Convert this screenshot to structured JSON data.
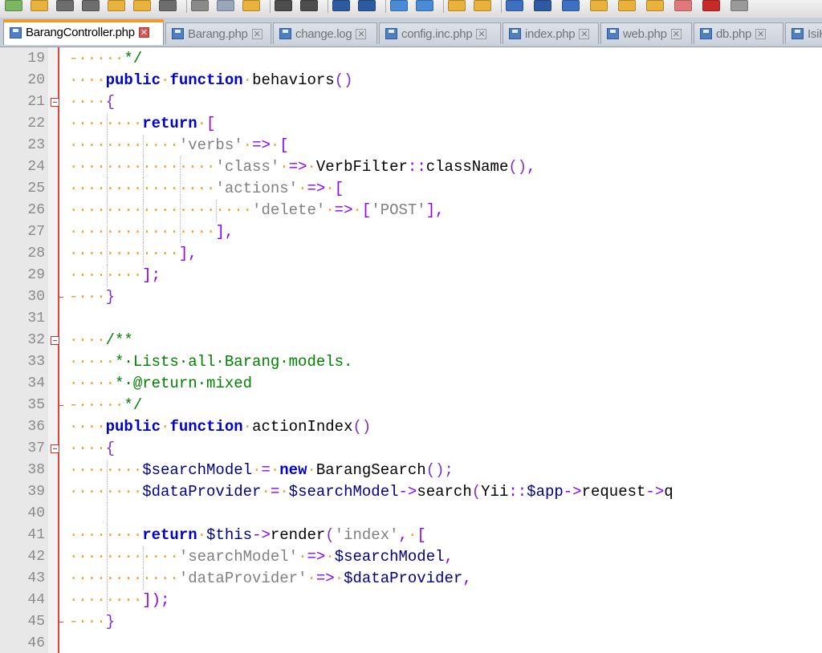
{
  "toolbar": {
    "icons": [
      "new-file-icon",
      "open-folder-icon",
      "save-icon",
      "save-all-icon",
      "close-icon",
      "close-all-icon",
      "print-icon",
      "cut-icon",
      "copy-icon",
      "paste-icon",
      "undo-icon",
      "redo-icon",
      "find-icon",
      "replace-icon",
      "zoom-in-icon",
      "zoom-out-icon",
      "sync-v-icon",
      "sync-h-icon",
      "word-wrap-icon",
      "all-chars-icon",
      "indent-guide-icon",
      "lang-icon",
      "doc-map-icon",
      "func-list-icon",
      "monitor-icon",
      "record-macro-icon",
      "stop-macro-icon"
    ]
  },
  "tabs": [
    {
      "label": "BarangController.php",
      "active": true
    },
    {
      "label": "Barang.php",
      "active": false
    },
    {
      "label": "change.log",
      "active": false
    },
    {
      "label": "config.inc.php",
      "active": false
    },
    {
      "label": "index.php",
      "active": false
    },
    {
      "label": "web.php",
      "active": false
    },
    {
      "label": "db.php",
      "active": false
    },
    {
      "label": "IsiKe",
      "active": false
    }
  ],
  "colors": {
    "keyword": "#0000c8",
    "operator": "#8b00ff",
    "string": "#808080",
    "comment": "#008000",
    "whitespace": "#f0a030",
    "fold_line": "#e34234",
    "active_tab_accent": "#f19a2c"
  },
  "editor": {
    "lines": [
      {
        "n": "19",
        "fold": "none",
        "guides": [],
        "tokens": [
          [
            "ws",
            "-·····"
          ],
          [
            "cm",
            "*/"
          ]
        ]
      },
      {
        "n": "20",
        "fold": "none",
        "guides": [],
        "tokens": [
          [
            "ws",
            "····"
          ],
          [
            "kw",
            "public"
          ],
          [
            "ws",
            "·"
          ],
          [
            "kw",
            "function"
          ],
          [
            "ws",
            "·"
          ],
          [
            "fn",
            "behaviors"
          ],
          [
            "p",
            "()"
          ]
        ]
      },
      {
        "n": "21",
        "fold": "open",
        "guides": [],
        "tokens": [
          [
            "ws",
            "····"
          ],
          [
            "p",
            "{"
          ]
        ]
      },
      {
        "n": "22",
        "fold": "none",
        "guides": [
          1
        ],
        "tokens": [
          [
            "ws",
            "········"
          ],
          [
            "kw",
            "return"
          ],
          [
            "ws",
            "·"
          ],
          [
            "op",
            "["
          ]
        ]
      },
      {
        "n": "23",
        "fold": "none",
        "guides": [
          1,
          2
        ],
        "tokens": [
          [
            "ws",
            "············"
          ],
          [
            "str",
            "'verbs'"
          ],
          [
            "ws",
            "·"
          ],
          [
            "op",
            "=>"
          ],
          [
            "ws",
            "·"
          ],
          [
            "op",
            "["
          ]
        ]
      },
      {
        "n": "24",
        "fold": "none",
        "guides": [
          1,
          2,
          3
        ],
        "tokens": [
          [
            "ws",
            "················"
          ],
          [
            "str",
            "'class'"
          ],
          [
            "ws",
            "·"
          ],
          [
            "op",
            "=>"
          ],
          [
            "ws",
            "·"
          ],
          [
            "id",
            "VerbFilter"
          ],
          [
            "op",
            "::"
          ],
          [
            "id",
            "className"
          ],
          [
            "p",
            "()"
          ],
          [
            "op",
            ","
          ]
        ]
      },
      {
        "n": "25",
        "fold": "none",
        "guides": [
          1,
          2,
          3
        ],
        "tokens": [
          [
            "ws",
            "················"
          ],
          [
            "str",
            "'actions'"
          ],
          [
            "ws",
            "·"
          ],
          [
            "op",
            "=>"
          ],
          [
            "ws",
            "·"
          ],
          [
            "op",
            "["
          ]
        ]
      },
      {
        "n": "26",
        "fold": "none",
        "guides": [
          1,
          2,
          3,
          4
        ],
        "tokens": [
          [
            "ws",
            "····················"
          ],
          [
            "str",
            "'delete'"
          ],
          [
            "ws",
            "·"
          ],
          [
            "op",
            "=>"
          ],
          [
            "ws",
            "·"
          ],
          [
            "op",
            "["
          ],
          [
            "str",
            "'POST'"
          ],
          [
            "op",
            "],"
          ]
        ]
      },
      {
        "n": "27",
        "fold": "none",
        "guides": [
          1,
          2,
          3
        ],
        "tokens": [
          [
            "ws",
            "················"
          ],
          [
            "op",
            "],"
          ]
        ]
      },
      {
        "n": "28",
        "fold": "none",
        "guides": [
          1,
          2
        ],
        "tokens": [
          [
            "ws",
            "············"
          ],
          [
            "op",
            "],"
          ]
        ]
      },
      {
        "n": "29",
        "fold": "none",
        "guides": [
          1
        ],
        "tokens": [
          [
            "ws",
            "········"
          ],
          [
            "op",
            "];"
          ]
        ]
      },
      {
        "n": "30",
        "fold": "close",
        "guides": [],
        "tokens": [
          [
            "ws",
            "-···"
          ],
          [
            "p",
            "}"
          ]
        ]
      },
      {
        "n": "31",
        "fold": "none",
        "guides": [],
        "tokens": []
      },
      {
        "n": "32",
        "fold": "open",
        "guides": [],
        "tokens": [
          [
            "ws",
            "····"
          ],
          [
            "cm",
            "/**"
          ]
        ]
      },
      {
        "n": "33",
        "fold": "none",
        "guides": [],
        "tokens": [
          [
            "ws",
            "·····"
          ],
          [
            "cm",
            "*·Lists·all·Barang·models."
          ]
        ]
      },
      {
        "n": "34",
        "fold": "none",
        "guides": [],
        "tokens": [
          [
            "ws",
            "·····"
          ],
          [
            "cm",
            "*·@return·mixed"
          ]
        ]
      },
      {
        "n": "35",
        "fold": "close",
        "guides": [],
        "tokens": [
          [
            "ws",
            "-·····"
          ],
          [
            "cm",
            "*/"
          ]
        ]
      },
      {
        "n": "36",
        "fold": "none",
        "guides": [],
        "tokens": [
          [
            "ws",
            "····"
          ],
          [
            "kw",
            "public"
          ],
          [
            "ws",
            "·"
          ],
          [
            "kw",
            "function"
          ],
          [
            "ws",
            "·"
          ],
          [
            "fn",
            "actionIndex"
          ],
          [
            "p",
            "()"
          ]
        ]
      },
      {
        "n": "37",
        "fold": "open",
        "guides": [],
        "tokens": [
          [
            "ws",
            "····"
          ],
          [
            "p",
            "{"
          ]
        ]
      },
      {
        "n": "38",
        "fold": "none",
        "guides": [
          1
        ],
        "tokens": [
          [
            "ws",
            "········"
          ],
          [
            "var",
            "$searchModel"
          ],
          [
            "ws",
            "·"
          ],
          [
            "op",
            "="
          ],
          [
            "ws",
            "·"
          ],
          [
            "kw2",
            "new"
          ],
          [
            "ws",
            "·"
          ],
          [
            "id",
            "BarangSearch"
          ],
          [
            "p",
            "();"
          ]
        ]
      },
      {
        "n": "39",
        "fold": "none",
        "guides": [
          1
        ],
        "tokens": [
          [
            "ws",
            "········"
          ],
          [
            "var",
            "$dataProvider"
          ],
          [
            "ws",
            "·"
          ],
          [
            "op",
            "="
          ],
          [
            "ws",
            "·"
          ],
          [
            "var",
            "$searchModel"
          ],
          [
            "op",
            "->"
          ],
          [
            "id",
            "search"
          ],
          [
            "p",
            "("
          ],
          [
            "id",
            "Yii"
          ],
          [
            "op",
            "::"
          ],
          [
            "var",
            "$app"
          ],
          [
            "op",
            "->"
          ],
          [
            "id",
            "request"
          ],
          [
            "op",
            "->"
          ],
          [
            "id",
            "q"
          ]
        ]
      },
      {
        "n": "40",
        "fold": "none",
        "guides": [
          1
        ],
        "tokens": []
      },
      {
        "n": "41",
        "fold": "none",
        "guides": [
          1
        ],
        "tokens": [
          [
            "ws",
            "········"
          ],
          [
            "kw",
            "return"
          ],
          [
            "ws",
            "·"
          ],
          [
            "var",
            "$this"
          ],
          [
            "op",
            "->"
          ],
          [
            "id",
            "render"
          ],
          [
            "p",
            "("
          ],
          [
            "str",
            "'index'"
          ],
          [
            "op",
            ","
          ],
          [
            "ws",
            "·"
          ],
          [
            "op",
            "["
          ]
        ]
      },
      {
        "n": "42",
        "fold": "none",
        "guides": [
          1,
          2
        ],
        "tokens": [
          [
            "ws",
            "············"
          ],
          [
            "str",
            "'searchModel'"
          ],
          [
            "ws",
            "·"
          ],
          [
            "op",
            "=>"
          ],
          [
            "ws",
            "·"
          ],
          [
            "var",
            "$searchModel"
          ],
          [
            "op",
            ","
          ]
        ]
      },
      {
        "n": "43",
        "fold": "none",
        "guides": [
          1,
          2
        ],
        "tokens": [
          [
            "ws",
            "············"
          ],
          [
            "str",
            "'dataProvider'"
          ],
          [
            "ws",
            "·"
          ],
          [
            "op",
            "=>"
          ],
          [
            "ws",
            "·"
          ],
          [
            "var",
            "$dataProvider"
          ],
          [
            "op",
            ","
          ]
        ]
      },
      {
        "n": "44",
        "fold": "none",
        "guides": [
          1
        ],
        "tokens": [
          [
            "ws",
            "········"
          ],
          [
            "op",
            "]);"
          ]
        ]
      },
      {
        "n": "45",
        "fold": "close",
        "guides": [],
        "tokens": [
          [
            "ws",
            "-···"
          ],
          [
            "p",
            "}"
          ]
        ]
      },
      {
        "n": "46",
        "fold": "none",
        "guides": [],
        "tokens": []
      }
    ]
  }
}
